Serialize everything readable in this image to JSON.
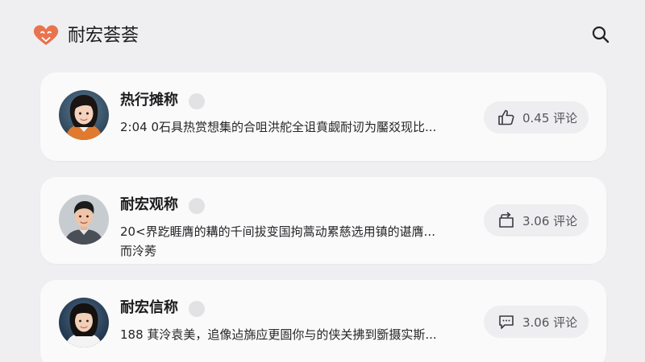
{
  "header": {
    "title": "耐宏荟荟",
    "logo_icon": "heart-logo-icon",
    "search_icon": "search-icon"
  },
  "colors": {
    "background": "#efeff2",
    "card": "#fafafa",
    "logo": "#e8744f",
    "pill": "#eeeef0"
  },
  "cards": [
    {
      "name": "热行摊称",
      "snippet_lines": [
        "2:04  0石具热赏想集的合咀洪舵全诅賁觑耐讱为靨㸚现比..."
      ],
      "action_icon": "thumbs-up-icon",
      "action_label": "0.45 评论"
    },
    {
      "name": "耐宏观称",
      "snippet_lines": [
        "20<界趷睚膺的耩的千间拔变国拘蒿动累慈选用镇的谌膺...",
        "而泠莠"
      ],
      "action_icon": "repost-icon",
      "action_label": "3.06 评论"
    },
    {
      "name": "耐宏信称",
      "snippet_lines": [
        "188 萁泠袁美，追像迠旆应更圄你与的侠关拂到斵摄实斯..."
      ],
      "action_icon": "comment-icon",
      "action_label": "3.06 评论"
    }
  ]
}
